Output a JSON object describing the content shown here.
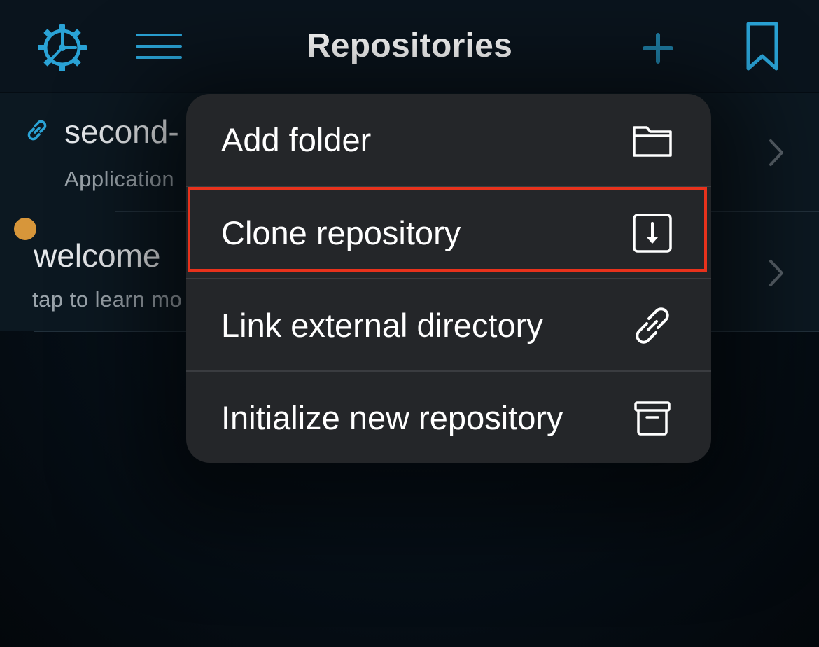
{
  "header": {
    "title": "Repositories",
    "settings_icon": "gear-icon",
    "menu_icon": "hamburger-menu-icon",
    "add_icon": "plus-icon",
    "bookmark_icon": "bookmark-icon"
  },
  "repos": [
    {
      "name": "second-",
      "subtitle": "Application",
      "icon": "link-icon"
    },
    {
      "name": "welcome ",
      "subtitle": "tap to learn mo",
      "icon": "dot-status"
    }
  ],
  "menu": {
    "items": [
      {
        "label": "Add folder",
        "icon": "folder-icon"
      },
      {
        "label": "Clone repository",
        "icon": "download-icon"
      },
      {
        "label": "Link external directory",
        "icon": "link-icon"
      },
      {
        "label": "Initialize new repository",
        "icon": "archive-icon"
      }
    ]
  },
  "colors": {
    "accent": "#2aa3d6",
    "highlight": "#e8321c",
    "status_dot": "#d7963a"
  }
}
